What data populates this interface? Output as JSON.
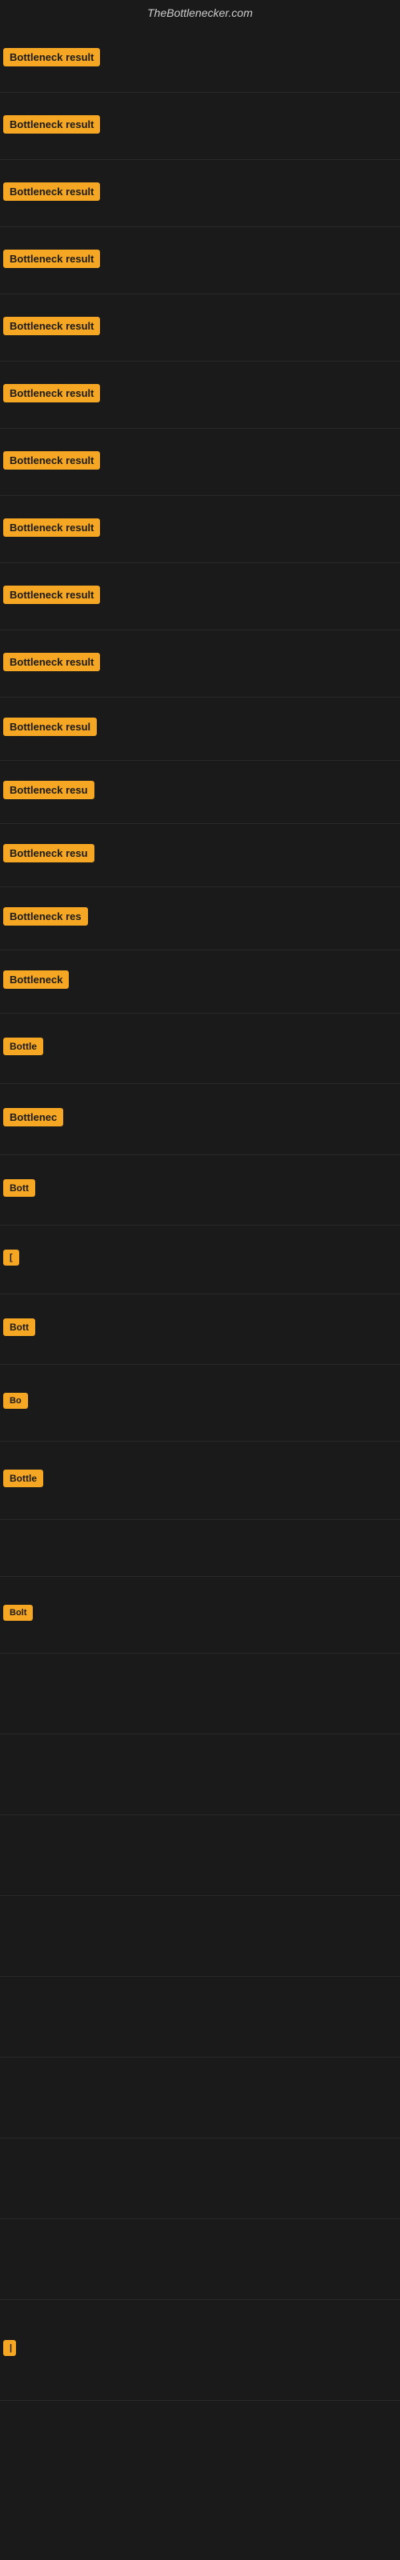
{
  "site": {
    "title": "TheBottlenecker.com"
  },
  "rows": [
    {
      "id": 1,
      "label": "Bottleneck result",
      "width": 155
    },
    {
      "id": 2,
      "label": "Bottleneck result",
      "width": 155
    },
    {
      "id": 3,
      "label": "Bottleneck result",
      "width": 155
    },
    {
      "id": 4,
      "label": "Bottleneck result",
      "width": 155
    },
    {
      "id": 5,
      "label": "Bottleneck result",
      "width": 155
    },
    {
      "id": 6,
      "label": "Bottleneck result",
      "width": 155
    },
    {
      "id": 7,
      "label": "Bottleneck result",
      "width": 155
    },
    {
      "id": 8,
      "label": "Bottleneck result",
      "width": 155
    },
    {
      "id": 9,
      "label": "Bottleneck result",
      "width": 155
    },
    {
      "id": 10,
      "label": "Bottleneck result",
      "width": 155
    },
    {
      "id": 11,
      "label": "Bottleneck resul",
      "width": 140
    },
    {
      "id": 12,
      "label": "Bottleneck resu",
      "width": 128
    },
    {
      "id": 13,
      "label": "Bottleneck resu",
      "width": 120
    },
    {
      "id": 14,
      "label": "Bottleneck res",
      "width": 110
    },
    {
      "id": 15,
      "label": "Bottleneck",
      "width": 90
    },
    {
      "id": 16,
      "label": "Bottle",
      "width": 65
    },
    {
      "id": 17,
      "label": "Bottlenec",
      "width": 80
    },
    {
      "id": 18,
      "label": "Bott",
      "width": 50
    },
    {
      "id": 19,
      "label": "[",
      "width": 20
    },
    {
      "id": 20,
      "label": "Bott",
      "width": 50
    },
    {
      "id": 21,
      "label": "Bo",
      "width": 35
    },
    {
      "id": 22,
      "label": "Bottle",
      "width": 65
    },
    {
      "id": 23,
      "label": "",
      "width": 0
    },
    {
      "id": 24,
      "label": "Bolt",
      "width": 45
    },
    {
      "id": 25,
      "label": "",
      "width": 0
    },
    {
      "id": 26,
      "label": "",
      "width": 0
    },
    {
      "id": 27,
      "label": "",
      "width": 0
    },
    {
      "id": 28,
      "label": "",
      "width": 0
    },
    {
      "id": 29,
      "label": "",
      "width": 0
    },
    {
      "id": 30,
      "label": "",
      "width": 0
    },
    {
      "id": 31,
      "label": "",
      "width": 0
    },
    {
      "id": 32,
      "label": "",
      "width": 0
    },
    {
      "id": 33,
      "label": "|",
      "width": 15
    }
  ]
}
